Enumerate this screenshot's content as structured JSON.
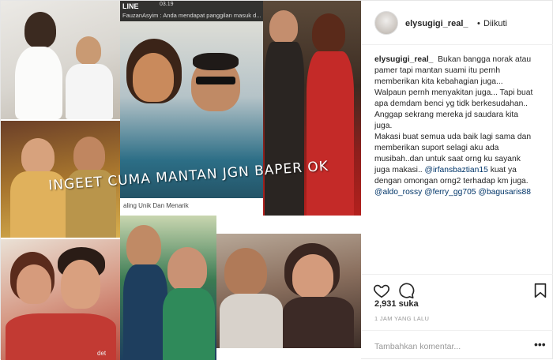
{
  "media": {
    "line_app": "LINE",
    "line_time": "03.19",
    "line_notification": "FauzanAsyim : Anda mendapat panggilan masuk d...",
    "caption_strip": "aling Unik Dan Menarik",
    "overlay_text": "INGEET CUMA MANTAN JGN BAPER OK",
    "watermark": "det"
  },
  "header": {
    "username": "elysugigi_real_",
    "separator": "•",
    "follow_status": "Diikuti"
  },
  "caption": {
    "author": "elysugigi_real_",
    "lines": [
      "Bukan bangga norak atau",
      "pamer tapi mantan suami itu pernh",
      "memberikan kita kebahagian juga...",
      "Walpaun pernh menyakitan juga... Tapi buat",
      "apa demdam benci yg tidk berkesudahan..",
      "Anggap sekrang mereka jd saudara kita",
      "juga.",
      "Makasi buat semua uda baik lagi sama dan",
      "memberikan suport selagi aku ada",
      "musibah..dan untuk saat orng ku sayank"
    ],
    "line11_pre": "juga makasi.. ",
    "mention1": "@irfansbaztian15",
    "line11_post": " kuat ya",
    "line12": "dengan omongan orng2 terhadap km juga.",
    "mention2": "@aldo_rossy",
    "mention3": "@ferry_gg705",
    "mention4": "@bagusaris88"
  },
  "stats": {
    "likes": "2,931 suka",
    "time_ago": "1 JAM YANG LALU"
  },
  "comment": {
    "placeholder": "Tambahkan komentar...",
    "more": "•••"
  },
  "icons": {
    "like": "heart-icon",
    "comment": "comment-icon",
    "save": "bookmark-icon",
    "more": "more-options-icon"
  }
}
